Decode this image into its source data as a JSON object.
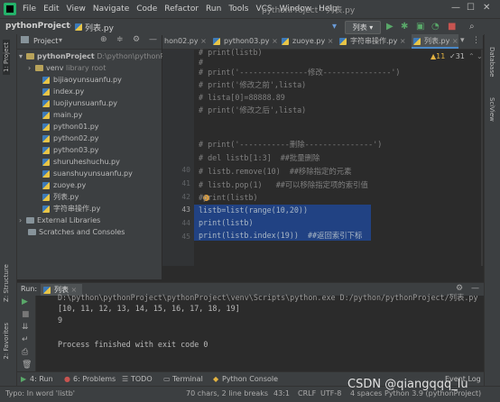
{
  "menu": {
    "items": [
      "File",
      "Edit",
      "View",
      "Navigate",
      "Code",
      "Refactor",
      "Run",
      "Tools",
      "VCS",
      "Window",
      "Help"
    ],
    "window_title": "pythonProject - 列表.py"
  },
  "navbar": {
    "project": "pythonProject",
    "file": "列表.py",
    "run_config": "列表"
  },
  "stripes": {
    "left_top": "1: Project",
    "left_structure": "Z: Structure",
    "left_favorites": "2: Favorites",
    "right_database": "Database",
    "right_sciview": "SciView"
  },
  "project_panel": {
    "title": "Project",
    "tree": [
      {
        "label": "pythonProject",
        "extra": "D:\\python\\pythonProject\\",
        "type": "root"
      },
      {
        "label": "venv",
        "extra": "library root",
        "type": "folder"
      },
      {
        "label": "bijiaoyunsuanfu.py",
        "type": "py"
      },
      {
        "label": "index.py",
        "type": "py"
      },
      {
        "label": "luojiyunsuanfu.py",
        "type": "py"
      },
      {
        "label": "main.py",
        "type": "py"
      },
      {
        "label": "python01.py",
        "type": "py"
      },
      {
        "label": "python02.py",
        "type": "py"
      },
      {
        "label": "python03.py",
        "type": "py"
      },
      {
        "label": "shuruheshuchu.py",
        "type": "py"
      },
      {
        "label": "suanshuyunsuanfu.py",
        "type": "py"
      },
      {
        "label": "zuoye.py",
        "type": "py"
      },
      {
        "label": "列表.py",
        "type": "py"
      },
      {
        "label": "字符串操作.py",
        "type": "py"
      },
      {
        "label": "External Libraries",
        "type": "lib"
      },
      {
        "label": "Scratches and Consoles",
        "type": "scratch"
      }
    ]
  },
  "tabs": [
    "hon02.py",
    "python03.py",
    "zuoye.py",
    "字符串操作.py",
    "列表.py"
  ],
  "editor": {
    "inspection": {
      "warnings": "11",
      "weak": "31"
    },
    "line_numbers": [
      "",
      "",
      "",
      "",
      "",
      "",
      "",
      "",
      "",
      "",
      "",
      "",
      "40",
      "41",
      "42",
      "43",
      "44",
      "45",
      "",
      ""
    ],
    "lines": [
      "# print(listb)",
      "#",
      "# print('---------------修改---------------')",
      "# print('修改之前',lista)",
      "# lista[0]=88888.89",
      "# print('修改之后',lista)",
      "",
      "",
      "# print('-----------删除---------------')",
      "# del listb[1:3]  ##批量删除",
      "# listb.remove(10)  ##移除指定的元素",
      "# listb.pop(1)   ##可以移除指定项的索引值",
      "#print(listb)",
      "listb=list(range(10,20))",
      "print(listb)",
      "print(listb.index(19))  ##返回索引下标"
    ]
  },
  "run_panel": {
    "label": "Run:",
    "tab": "列表",
    "output": [
      "D:\\python\\pythonProject\\pythonProject\\venv\\Scripts\\python.exe D:/python/pythonProject/列表.py",
      "[10, 11, 12, 13, 14, 15, 16, 17, 18, 19]",
      "9",
      "",
      "Process finished with exit code 0"
    ]
  },
  "bottom_tabs": [
    "4: Run",
    "6: Problems",
    "TODO",
    "Terminal",
    "Python Console",
    "Event Log"
  ],
  "status": {
    "message": "Typo: In word 'listb'",
    "chars": "70 chars, 2 line breaks",
    "pos": "43:1",
    "crlf": "CRLF",
    "enc": "UTF-8",
    "indent": "4 spaces",
    "interp": "Python 3.9 (pythonProject)"
  },
  "watermark": "CSDN @qiangqqq_lu"
}
